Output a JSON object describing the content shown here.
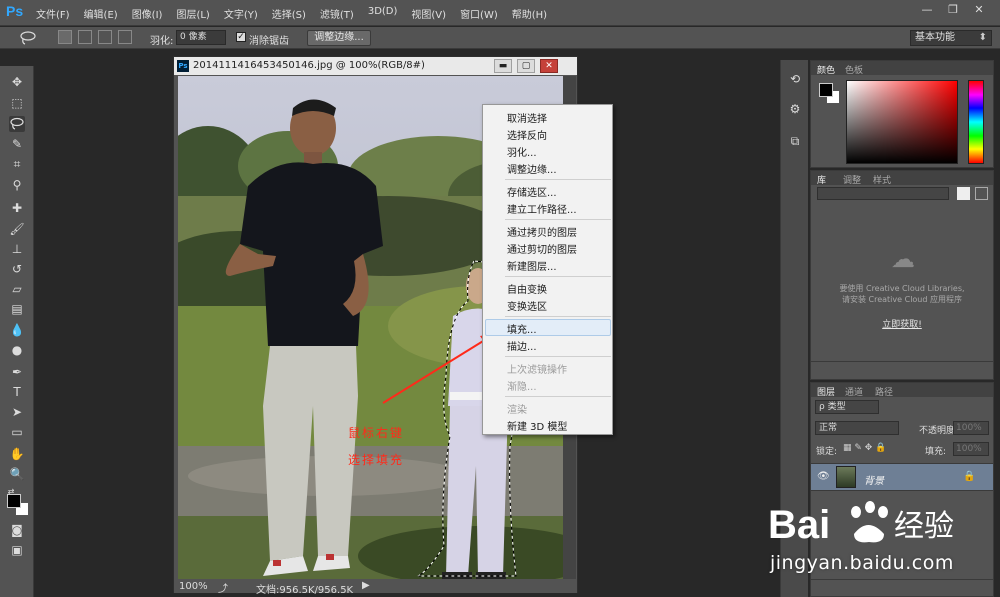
{
  "app": {
    "logo": "Ps"
  },
  "menubar": {
    "items": [
      "文件(F)",
      "编辑(E)",
      "图像(I)",
      "图层(L)",
      "文字(Y)",
      "选择(S)",
      "滤镜(T)",
      "3D(D)",
      "视图(V)",
      "窗口(W)",
      "帮助(H)"
    ],
    "minimize": "—",
    "restore": "❐",
    "close": "✕"
  },
  "options": {
    "feather_label": "羽化:",
    "feather_value": "0 像素",
    "antialias_checked": "✓",
    "antialias_label": "消除锯齿",
    "refine_button": "调整边缘...",
    "workspace": "基本功能"
  },
  "document": {
    "title": "20141114164534501​46.jpg @ 100%(RGB/8#)",
    "minimize": "▬",
    "restore": "▢",
    "close": "✕",
    "zoom": "100%",
    "doc_size": "文档:956.5K/956.5K",
    "arrow": "▶"
  },
  "context_menu": {
    "items": [
      {
        "label": "取消选择",
        "enabled": true
      },
      {
        "label": "选择反向",
        "enabled": true
      },
      {
        "label": "羽化...",
        "enabled": true
      },
      {
        "label": "调整边缘...",
        "enabled": true
      },
      {
        "label": "存储选区...",
        "enabled": true
      },
      {
        "label": "建立工作路径...",
        "enabled": true
      },
      {
        "label": "通过拷贝的图层",
        "enabled": true
      },
      {
        "label": "通过剪切的图层",
        "enabled": true
      },
      {
        "label": "新建图层...",
        "enabled": true
      },
      {
        "label": "自由变换",
        "enabled": true
      },
      {
        "label": "变换选区",
        "enabled": true
      },
      {
        "label": "填充...",
        "enabled": true,
        "highlighted": true
      },
      {
        "label": "描边...",
        "enabled": true
      },
      {
        "label": "上次滤镜操作",
        "enabled": false
      },
      {
        "label": "渐隐...",
        "enabled": false
      },
      {
        "label": "渲染",
        "enabled": false
      },
      {
        "label": "新建 3D 模型",
        "enabled": true
      }
    ]
  },
  "annotation": {
    "line1": "鼠标右键",
    "line2": "选择填充",
    "color": "#ff2a1a"
  },
  "panels": {
    "color": {
      "tabs": [
        "颜色",
        "色板"
      ]
    },
    "library": {
      "tabs": [
        "库",
        "调整",
        "样式"
      ],
      "message_line1": "要使用 Creative Cloud Libraries,",
      "message_line2": "请安装 Creative Cloud 应用程序",
      "link": "立即获取!"
    },
    "layers": {
      "tabs": [
        "图层",
        "通道",
        "路径"
      ],
      "filter_kind": "ρ 类型",
      "blend_mode": "正常",
      "opacity_label": "不透明度:",
      "opacity_value": "100%",
      "lock_label": "锁定:",
      "fill_label": "填充:",
      "fill_value": "100%",
      "layer_name": "背景"
    }
  },
  "watermark": {
    "logo_text": "Bai",
    "logo_suffix": "经验",
    "url": "jingyan.baidu.com"
  }
}
